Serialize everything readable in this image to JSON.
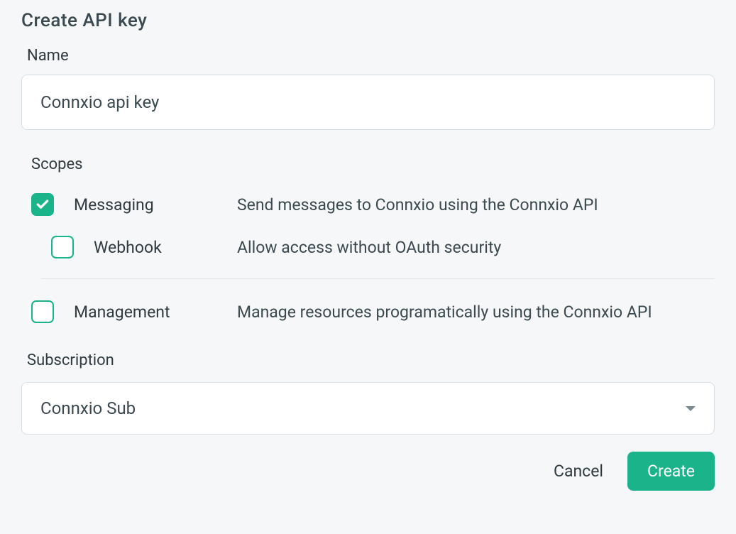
{
  "title": "Create API key",
  "nameLabel": "Name",
  "nameValue": "Connxio api key",
  "scopesLabel": "Scopes",
  "scopes": {
    "messaging": {
      "name": "Messaging",
      "description": "Send messages to Connxio using the Connxio API"
    },
    "webhook": {
      "name": "Webhook",
      "description": "Allow access without OAuth security"
    },
    "management": {
      "name": "Management",
      "description": "Manage resources programatically using the Connxio API"
    }
  },
  "subscriptionLabel": "Subscription",
  "subscriptionValue": "Connxio Sub",
  "buttons": {
    "cancel": "Cancel",
    "create": "Create"
  }
}
